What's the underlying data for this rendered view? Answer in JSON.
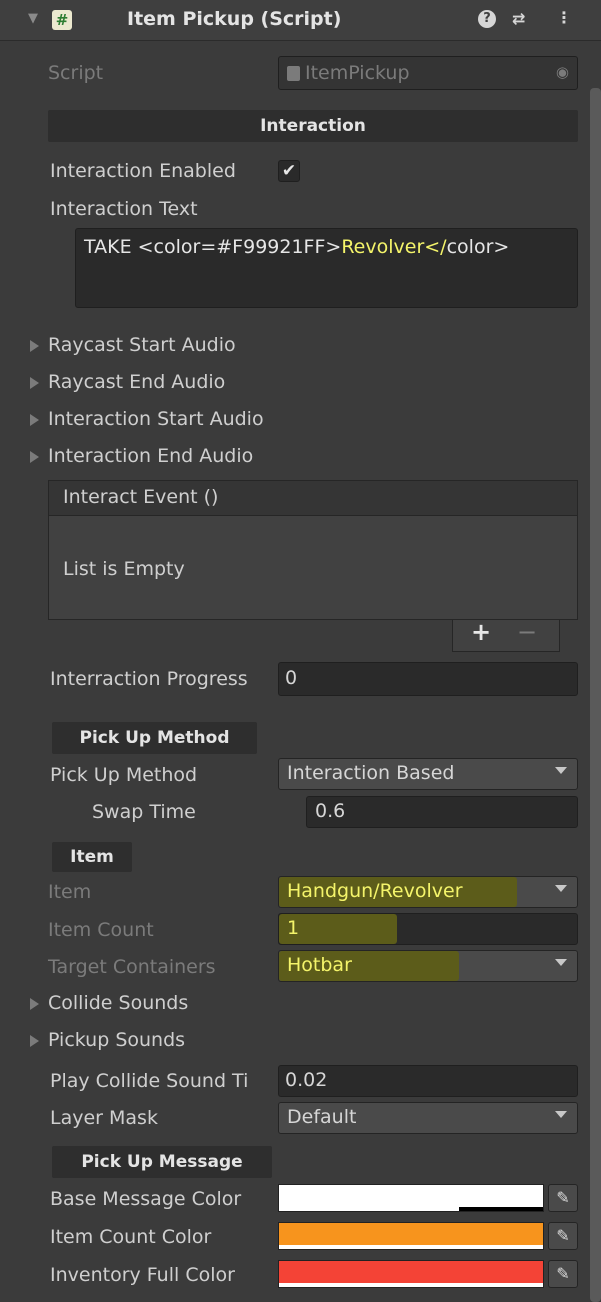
{
  "header": {
    "fold_glyph": "▼",
    "script_icon_glyph": "#",
    "title": "Item Pickup (Script)",
    "help_glyph": "?",
    "settings_glyph": "⇄",
    "more_glyph": "⋮"
  },
  "script_row": {
    "label": "Script",
    "value": "ItemPickup",
    "target_glyph": "◉"
  },
  "interaction": {
    "section_title": "Interaction",
    "enabled_label": "Interaction Enabled",
    "enabled_checked": true,
    "check_glyph": "✔",
    "text_label": "Interaction Text",
    "text_part1": "TAKE <color=#F99921FF>",
    "text_part2": "Revolver</",
    "text_part3": "color>"
  },
  "foldouts": [
    {
      "label": "Raycast Start Audio"
    },
    {
      "label": "Raycast End Audio"
    },
    {
      "label": "Interaction Start Audio"
    },
    {
      "label": "Interaction End Audio"
    }
  ],
  "event": {
    "title": "Interact Event ()",
    "empty_text": "List is Empty",
    "add_glyph": "+",
    "remove_glyph": "−"
  },
  "progress": {
    "label": "Interraction Progress",
    "value": "0"
  },
  "pickup_method": {
    "section_title": "Pick Up Method",
    "label": "Pick Up Method",
    "value": "Interaction Based",
    "swap_label": "Swap Time",
    "swap_value": "0.6"
  },
  "item": {
    "section_title": "Item",
    "item_label": "Item",
    "item_value": "Handgun/Revolver",
    "count_label": "Item Count",
    "count_value": "1",
    "containers_label": "Target Containers",
    "containers_value": "Hotbar",
    "collide_label": "Collide Sounds",
    "pickup_label": "Pickup Sounds",
    "play_label": "Play Collide Sound Ti",
    "play_value": "0.02",
    "layer_label": "Layer Mask",
    "layer_value": "Default"
  },
  "message": {
    "section_title": "Pick Up Message",
    "base_label": "Base Message Color",
    "base_color": "#ffffff",
    "count_label": "Item Count Color",
    "count_color": "#f7941d",
    "full_label": "Inventory Full Color",
    "full_color": "#f44336",
    "picker_glyph": "✎"
  },
  "colors": {
    "highlight": "#f4f46a",
    "orange_text": "#f99921"
  }
}
